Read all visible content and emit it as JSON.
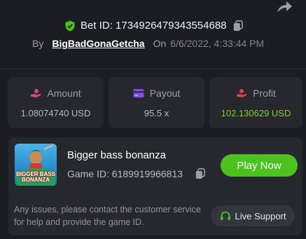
{
  "header": {
    "bet_id_label": "Bet ID: 1734926479343554688",
    "by_label": "By",
    "username": "BigBadGonaGetcha",
    "on_label": "On",
    "timestamp": "6/6/2022, 4:33:44 PM"
  },
  "stats": [
    {
      "label": "Amount",
      "value": "1.08074740 USD",
      "icon": "money-hand-icon"
    },
    {
      "label": "Payout",
      "value": "95.5 x",
      "icon": "card-icon"
    },
    {
      "label": "Profit",
      "value": "102.130629 USD",
      "icon": "profit-hand-icon"
    }
  ],
  "game": {
    "name": "Bigger bass bonanza",
    "id_label": "Game ID: 6189919966813",
    "thumb_text": "BIGGER BASS BONANZA",
    "play_label": "Play Now",
    "hint": "Any issues, please contact the customer service for help and provide the game ID.",
    "support_label": "Live Support"
  },
  "colors": {
    "accent_green": "#4cc21f",
    "profit_green": "#7ed321",
    "amount_pink": "#e0467a",
    "payout_purple": "#8a4fe0",
    "profit_red": "#e2433f"
  }
}
